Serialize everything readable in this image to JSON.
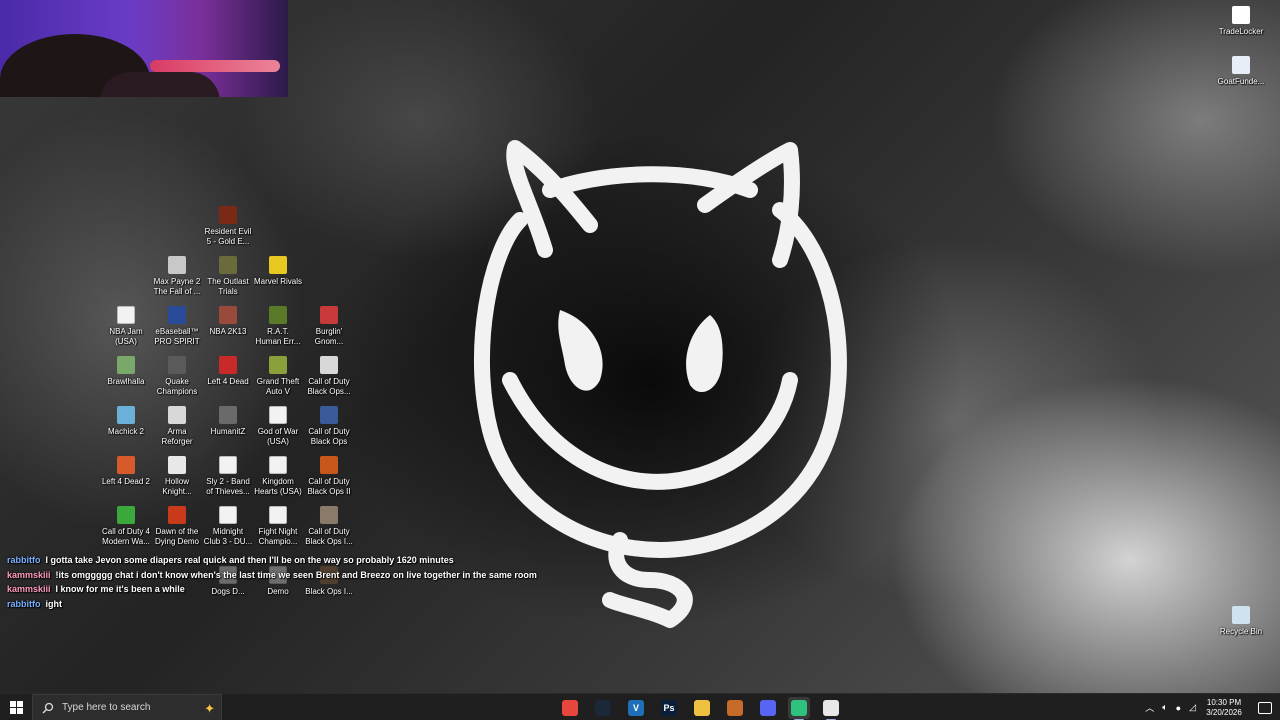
{
  "desktop_icons": [
    {
      "label": "TradeLocker",
      "icon": "tradelocker-icon",
      "color": "#ffffff"
    },
    {
      "label": "GoatFunde...",
      "icon": "goatfunded-icon",
      "color": "#e8eef8"
    },
    {
      "label": "Resident Evil\n5 - Gold E...",
      "icon": "resident-evil-icon",
      "color": "#7a2a14"
    },
    {
      "label": "Max Payne 2\nThe Fall of ...",
      "icon": "max-payne-icon",
      "color": "#c8c8c8"
    },
    {
      "label": "The Outlast\nTrials",
      "icon": "outlast-icon",
      "color": "#6a6a3a"
    },
    {
      "label": "Marvel Rivals",
      "icon": "marvel-rivals-icon",
      "color": "#e8c820"
    },
    {
      "label": "NBA Jam\n(USA)",
      "icon": "file-icon",
      "color": "#f2f2f2"
    },
    {
      "label": "eBaseball™\nPRO SPIRIT",
      "icon": "ebaseball-icon",
      "color": "#2a4a9a"
    },
    {
      "label": "NBA 2K13",
      "icon": "nba2k13-icon",
      "color": "#9a4a3a"
    },
    {
      "label": "R.A.T.\nHuman Err...",
      "icon": "rat-icon",
      "color": "#5a7a2a"
    },
    {
      "label": "Burglin'\nGnom...",
      "icon": "burglin-icon",
      "color": "#c83a3a"
    },
    {
      "label": "Brawlhalla",
      "icon": "brawlhalla-icon",
      "color": "#7aa86a"
    },
    {
      "label": "Quake\nChampions",
      "icon": "quake-icon",
      "color": "#5a5a5a"
    },
    {
      "label": "Left 4 Dead",
      "icon": "left4dead-icon",
      "color": "#c82a2a"
    },
    {
      "label": "Grand Theft\nAuto V",
      "icon": "gta-icon",
      "color": "#8aa03a"
    },
    {
      "label": "Call of Duty\nBlack Ops...",
      "icon": "cod-icon",
      "color": "#d8d8d8"
    },
    {
      "label": "Machick 2",
      "icon": "machick-icon",
      "color": "#6ab0d8"
    },
    {
      "label": "Arma\nReforger",
      "icon": "arma-icon",
      "color": "#d8d8d8"
    },
    {
      "label": "HumanitZ",
      "icon": "humanitz-icon",
      "color": "#6a6a6a"
    },
    {
      "label": "God of War\n(USA)",
      "icon": "file-icon",
      "color": "#f2f2f2"
    },
    {
      "label": "Call of Duty\nBlack Ops",
      "icon": "cod-icon",
      "color": "#3a5a9a"
    },
    {
      "label": "Left 4 Dead 2",
      "icon": "left4dead2-icon",
      "color": "#d85a2a"
    },
    {
      "label": "Hollow\nKnight...",
      "icon": "hollow-knight-icon",
      "color": "#e8e8e8"
    },
    {
      "label": "Sly 2 - Band\nof Thieves...",
      "icon": "file-icon",
      "color": "#f2f2f2"
    },
    {
      "label": "Kingdom\nHearts (USA)",
      "icon": "file-icon",
      "color": "#f2f2f2"
    },
    {
      "label": "Call of Duty\nBlack Ops II",
      "icon": "cod-bo2-icon",
      "color": "#c8581a"
    },
    {
      "label": "Call of Duty 4\nModern Wa...",
      "icon": "cod4-icon",
      "color": "#3aa83a"
    },
    {
      "label": "Dawn of the\nDying Demo",
      "icon": "dawn-icon",
      "color": "#c83a1a"
    },
    {
      "label": "Midnight\nClub 3 - DU...",
      "icon": "file-icon",
      "color": "#f2f2f2"
    },
    {
      "label": "Fight Night\nChampio...",
      "icon": "file-icon",
      "color": "#f2f2f2"
    },
    {
      "label": "Call of Duty\nBlack Ops I...",
      "icon": "cod-icon",
      "color": "#8a7a6a"
    },
    {
      "label": "Dogs D...",
      "icon": "file-icon",
      "color": "#f2f2f2"
    },
    {
      "label": "Demo",
      "icon": "file-icon",
      "color": "#f2f2f2"
    },
    {
      "label": "Black Ops I...",
      "icon": "cod-icon",
      "color": "#9a6a3a"
    },
    {
      "label": "Recycle Bin",
      "icon": "recycle-bin-icon",
      "color": "#cfe2f0"
    }
  ],
  "chat": [
    {
      "user": "rabbitfo",
      "user_color": "#7ab0ff",
      "message": "I gotta take Jevon some diapers real quick and then I'll be on the way so probably 1620 minutes"
    },
    {
      "user": "kammskiii",
      "user_color": "#ff9ac0",
      "message": "!its omggggg chat i don't know when's the last time we seen Brent and Breezo on live together in the same room"
    },
    {
      "user": "kammskiii",
      "user_color": "#ff9ac0",
      "message": "I know for me it's been a while"
    },
    {
      "user": "rabbitfo",
      "user_color": "#7ab0ff",
      "message": "ight"
    }
  ],
  "taskbar": {
    "search_placeholder": "Type here to search",
    "apps": [
      {
        "name": "chrome-icon",
        "glyph": "",
        "color": "#e8453c"
      },
      {
        "name": "steam-icon",
        "glyph": "",
        "color": "#1b2838"
      },
      {
        "name": "vscode-icon",
        "glyph": "V",
        "color": "#1e6fb8"
      },
      {
        "name": "photoshop-icon",
        "glyph": "Ps",
        "color": "#0b1e3a"
      },
      {
        "name": "file-explorer-icon",
        "glyph": "",
        "color": "#f0c040"
      },
      {
        "name": "game-launcher-icon",
        "glyph": "",
        "color": "#c86a2a"
      },
      {
        "name": "discord-icon",
        "glyph": "",
        "color": "#5865f2"
      },
      {
        "name": "green-app-icon",
        "glyph": "",
        "color": "#2ec27e"
      },
      {
        "name": "window-app-icon",
        "glyph": "",
        "color": "#e8e8e8"
      }
    ],
    "time": "10:30 PM",
    "date": "3/20/2026"
  }
}
